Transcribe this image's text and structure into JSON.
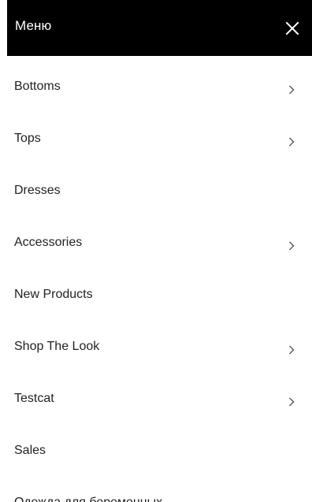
{
  "header": {
    "title": "Меню",
    "close_icon": "close-icon"
  },
  "menu": {
    "items": [
      {
        "label": "Bottoms",
        "has_submenu": true
      },
      {
        "label": "Tops",
        "has_submenu": true
      },
      {
        "label": "Dresses",
        "has_submenu": false
      },
      {
        "label": "Accessories",
        "has_submenu": true
      },
      {
        "label": "New Products",
        "has_submenu": false
      },
      {
        "label": "Shop The Look",
        "has_submenu": true
      },
      {
        "label": "Testcat",
        "has_submenu": true
      },
      {
        "label": "Sales",
        "has_submenu": false
      },
      {
        "label": "Одежда для беременных",
        "has_submenu": false
      }
    ],
    "chevron_icon": "chevron-right-icon"
  },
  "colors": {
    "header_background": "#000000",
    "header_text": "#ffffff",
    "item_text": "#222222",
    "chevron": "#555555",
    "background": "#ffffff"
  }
}
